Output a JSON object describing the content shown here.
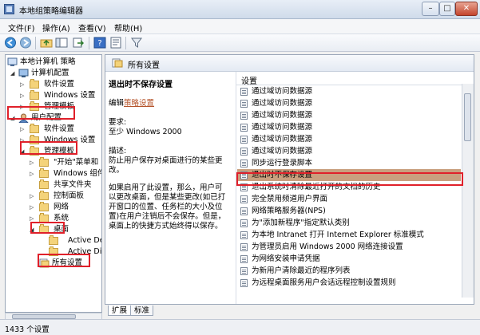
{
  "window": {
    "title": "本地组策略编辑器"
  },
  "menu": [
    {
      "label": "文件(F)"
    },
    {
      "label": "操作(A)"
    },
    {
      "label": "查看(V)"
    },
    {
      "label": "帮助(H)"
    }
  ],
  "tree": {
    "root": "本地计算机 策略",
    "computer_config": "计算机配置",
    "cc_software": "软件设置",
    "cc_windows": "Windows 设置",
    "cc_admin": "管理模板",
    "user_config": "用户配置",
    "uc_software": "软件设置",
    "uc_windows": "Windows 设置",
    "uc_admin": "管理模板",
    "start_menu": "\"开始\"菜单和",
    "windows_comp": "Windows 组件",
    "shared_folders": "共享文件夹",
    "control_panel": "控制面板",
    "network": "网络",
    "system": "系统",
    "desktop": "桌面",
    "active_desktop": "Active De",
    "active_directory": "Active Dir",
    "all_settings": "所有设置"
  },
  "right_header": {
    "title": "所有设置"
  },
  "description": {
    "title": "退出时不保存设置",
    "edit_prefix": "编辑",
    "edit_link": "策略设置",
    "requirements_label": "要求:",
    "requirements_value": "至少 Windows 2000",
    "desc_label": "描述:",
    "desc_text": "防止用户保存对桌面进行的某些更改。",
    "detail_text": "如果启用了此设置，那么，用户可以更改桌面，但是某些更改(如已打开窗口的位置、任务栏的大小及位置)在用户注销后不会保存。但是，桌面上的快捷方式始终得以保存。"
  },
  "list": {
    "header": "设置",
    "rows": [
      "通过域访问数据源",
      "通过域访问数据源",
      "通过域访问数据源",
      "通过域访问数据源",
      "通过域访问数据源",
      "通过域访问数据源",
      "同步运行登录脚本",
      "退出时不保存设置",
      "退出系统时清除最近打开的文档的历史",
      "完全禁用频道用户界面",
      "网络策略服务器(NPS)",
      "为\"添加新程序\"指定默认类别",
      "为本地 Intranet 打开 Internet Explorer 标准模式",
      "为管理员启用 Windows 2000 网络连接设置",
      "为网络安装申请凭据",
      "为新用户清除最近的程序列表",
      "为远程桌面服务用户会话远程控制设置规则"
    ],
    "selected_index": 7
  },
  "tabs": [
    {
      "label": "扩展"
    },
    {
      "label": "标准"
    }
  ],
  "status": {
    "text": "1433 个设置"
  }
}
